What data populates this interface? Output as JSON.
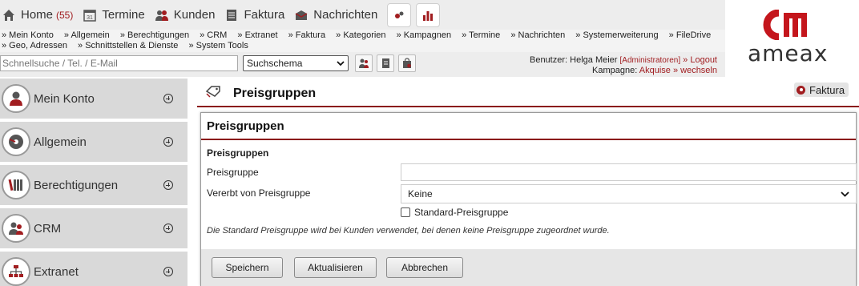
{
  "topnav": {
    "items": [
      {
        "label": "Home",
        "count": "(55)"
      },
      {
        "label": "Termine"
      },
      {
        "label": "Kunden"
      },
      {
        "label": "Faktura"
      },
      {
        "label": "Nachrichten"
      }
    ]
  },
  "sublinks": [
    "» Mein Konto",
    "» Allgemein",
    "» Berechtigungen",
    "» CRM",
    "» Extranet",
    "» Faktura",
    "» Kategorien",
    "» Kampagnen",
    "» Termine",
    "» Nachrichten",
    "» Systemerweiterung",
    "» FileDrive",
    "» Geo, Adressen",
    "» Schnittstellen & Dienste",
    "» System Tools"
  ],
  "search": {
    "placeholder": "Schnellsuche / Tel. / E-Mail",
    "schema_value": "Suchschema"
  },
  "user": {
    "prefix": "Benutzer:",
    "name": "Helga Meier",
    "role": "[Administratoren]",
    "logout": "» Logout",
    "campaign_prefix": "Kampagne:",
    "campaign": "Akquise",
    "switch": "» wechseln"
  },
  "logo": {
    "text": "ameax"
  },
  "sidebar": {
    "items": [
      {
        "label": "Mein Konto"
      },
      {
        "label": "Allgemein"
      },
      {
        "label": "Berechtigungen"
      },
      {
        "label": "CRM"
      },
      {
        "label": "Extranet"
      }
    ]
  },
  "page": {
    "title": "Preisgruppen",
    "context_chip": "Faktura"
  },
  "form": {
    "panel_title": "Preisgruppen",
    "section_title": "Preisgruppen",
    "field_preisgruppe_label": "Preisgruppe",
    "field_preisgruppe_value": "",
    "field_vererbt_label": "Vererbt von Preisgruppe",
    "field_vererbt_value": "Keine",
    "checkbox_label": "Standard-Preisgruppe",
    "checkbox_checked": false,
    "hint": "Die Standard Preisgruppe wird bei Kunden verwendet, bei denen keine Preisgruppe zugeordnet wurde.",
    "buttons": {
      "save": "Speichern",
      "refresh": "Aktualisieren",
      "cancel": "Abbrechen"
    }
  },
  "colors": {
    "accent": "#a11d20",
    "divider": "#8b1a1a",
    "sidebar_bg": "#d9d9d9",
    "nav_bg": "#ededed"
  }
}
